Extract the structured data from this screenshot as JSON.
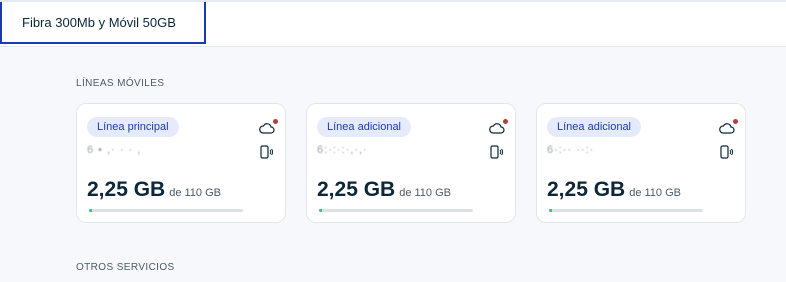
{
  "tabs": [
    {
      "label": "Fibra 300Mb y Móvil 50GB",
      "active": true
    }
  ],
  "sections": {
    "lineas_moviles": "LÍNEAS MÓVILES",
    "otros_servicios": "OTROS SERVICIOS"
  },
  "cards": [
    {
      "badge": "Línea principal",
      "number_masked": "6  • ,·   ·  · ,",
      "used": "2,25 GB",
      "limit": "de 110 GB",
      "progress": 0.02
    },
    {
      "badge": "Línea adicional",
      "number_masked": "6:·:·:·,·,·",
      "used": "2,25 GB",
      "limit": "de 110 GB",
      "progress": 0.02
    },
    {
      "badge": "Línea adicional",
      "number_masked": "6·:·· ··:·",
      "used": "2,25 GB",
      "limit": "de 110 GB",
      "progress": 0.02
    }
  ],
  "colors": {
    "accent": "#1c3aa9",
    "badge_bg": "#e5ebfa",
    "progress": "#3cc27a",
    "status_dot": "#b0403a"
  },
  "icons": [
    "cloud-icon",
    "phone-signal-icon"
  ]
}
